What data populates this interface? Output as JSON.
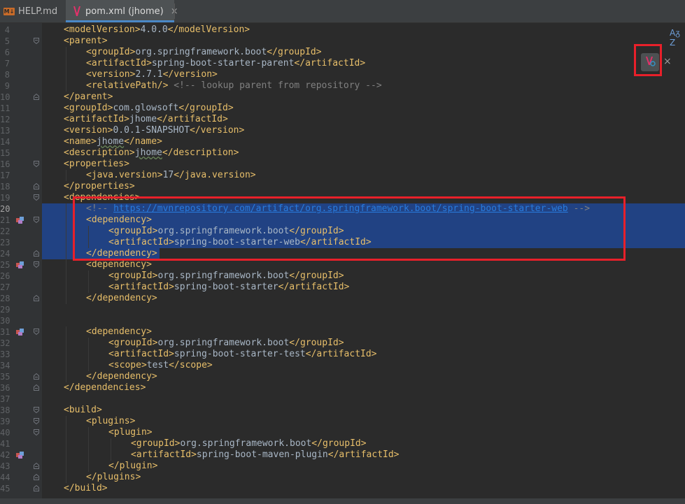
{
  "tabs": [
    {
      "label": "HELP.md",
      "icon": "markdown-icon",
      "icon_text": "M↓",
      "active": false
    },
    {
      "label": "pom.xml (jhome)",
      "icon": "maven-icon",
      "active": true
    }
  ],
  "tab_close_glyph": "×",
  "toolbar": {
    "reader_mode_glyph": "Aᵹ Z",
    "load_maven_icon": "maven-reload-icon",
    "close_glyph": "×"
  },
  "colors": {
    "tag": "#e8bf6a",
    "text": "#a9b7c6",
    "comment": "#808080",
    "link": "#287bde",
    "selection": "#214283",
    "highlight_box": "#e8202a"
  },
  "lines": [
    {
      "num": "4",
      "indent": 1,
      "tokens": [
        [
          "tag",
          "<modelVersion>"
        ],
        [
          "txt",
          "4.0.0"
        ],
        [
          "tag",
          "</modelVersion>"
        ]
      ]
    },
    {
      "num": "5",
      "indent": 1,
      "fold": "open",
      "tokens": [
        [
          "tag",
          "<parent>"
        ]
      ]
    },
    {
      "num": "6",
      "indent": 2,
      "tokens": [
        [
          "tag",
          "<groupId>"
        ],
        [
          "txt",
          "org.springframework.boot"
        ],
        [
          "tag",
          "</groupId>"
        ]
      ]
    },
    {
      "num": "7",
      "indent": 2,
      "tokens": [
        [
          "tag",
          "<artifactId>"
        ],
        [
          "txt",
          "spring-boot-starter-parent"
        ],
        [
          "tag",
          "</artifactId>"
        ]
      ]
    },
    {
      "num": "8",
      "indent": 2,
      "tokens": [
        [
          "tag",
          "<version>"
        ],
        [
          "txt",
          "2.7.1"
        ],
        [
          "tag",
          "</version>"
        ]
      ]
    },
    {
      "num": "9",
      "indent": 2,
      "tokens": [
        [
          "tag",
          "<relativePath/>"
        ],
        [
          "txt",
          " "
        ],
        [
          "cmt",
          "<!-- lookup parent from repository -->"
        ]
      ]
    },
    {
      "num": "10",
      "indent": 1,
      "fold": "close",
      "tokens": [
        [
          "tag",
          "</parent>"
        ]
      ]
    },
    {
      "num": "11",
      "indent": 1,
      "tokens": [
        [
          "tag",
          "<groupId>"
        ],
        [
          "txt",
          "com.glowsoft"
        ],
        [
          "tag",
          "</groupId>"
        ]
      ]
    },
    {
      "num": "12",
      "indent": 1,
      "tokens": [
        [
          "tag",
          "<artifactId>"
        ],
        [
          "txt",
          "jhome"
        ],
        [
          "tag",
          "</artifactId>"
        ]
      ]
    },
    {
      "num": "13",
      "indent": 1,
      "tokens": [
        [
          "tag",
          "<version>"
        ],
        [
          "txt",
          "0.0.1-SNAPSHOT"
        ],
        [
          "tag",
          "</version>"
        ]
      ]
    },
    {
      "num": "14",
      "indent": 1,
      "tokens": [
        [
          "tag",
          "<name>"
        ],
        [
          "wav",
          "jhome"
        ],
        [
          "tag",
          "</name>"
        ]
      ]
    },
    {
      "num": "15",
      "indent": 1,
      "tokens": [
        [
          "tag",
          "<description>"
        ],
        [
          "wav",
          "jhome"
        ],
        [
          "tag",
          "</description>"
        ]
      ]
    },
    {
      "num": "16",
      "indent": 1,
      "fold": "open",
      "tokens": [
        [
          "tag",
          "<properties>"
        ]
      ]
    },
    {
      "num": "17",
      "indent": 2,
      "tokens": [
        [
          "tag",
          "<java.version>"
        ],
        [
          "txt",
          "17"
        ],
        [
          "tag",
          "</java.version>"
        ]
      ]
    },
    {
      "num": "18",
      "indent": 1,
      "fold": "close",
      "tokens": [
        [
          "tag",
          "</properties>"
        ]
      ]
    },
    {
      "num": "19",
      "indent": 1,
      "fold": "open",
      "tokens": [
        [
          "tag",
          "<dependencies>"
        ]
      ]
    },
    {
      "num": "20",
      "indent": 2,
      "sel": true,
      "cur": true,
      "tokens": [
        [
          "cmt",
          "<!-- "
        ],
        [
          "url",
          "https://mvnrepository.com/artifact/org.springframework.boot/spring-boot-starter-web"
        ],
        [
          "cmt",
          " -->"
        ]
      ]
    },
    {
      "num": "21",
      "indent": 2,
      "sel": true,
      "fold": "open",
      "gicon": true,
      "tokens": [
        [
          "tag",
          "<dependency>"
        ]
      ]
    },
    {
      "num": "22",
      "indent": 3,
      "sel": true,
      "tokens": [
        [
          "tag",
          "<groupId>"
        ],
        [
          "txt",
          "org.springframework.boot"
        ],
        [
          "tag",
          "</groupId>"
        ]
      ]
    },
    {
      "num": "23",
      "indent": 3,
      "sel": true,
      "tokens": [
        [
          "tag",
          "<artifactId>"
        ],
        [
          "txt",
          "spring-boot-starter-web"
        ],
        [
          "tag",
          "</artifactId>"
        ]
      ]
    },
    {
      "num": "24",
      "indent": 2,
      "sel": true,
      "last": true,
      "fold": "close",
      "tokens": [
        [
          "tag",
          "</dependency>"
        ]
      ]
    },
    {
      "num": "25",
      "indent": 2,
      "fold": "open",
      "gicon": true,
      "tokens": [
        [
          "tag",
          "<dependency>"
        ]
      ]
    },
    {
      "num": "26",
      "indent": 3,
      "tokens": [
        [
          "tag",
          "<groupId>"
        ],
        [
          "txt",
          "org.springframework.boot"
        ],
        [
          "tag",
          "</groupId>"
        ]
      ]
    },
    {
      "num": "27",
      "indent": 3,
      "tokens": [
        [
          "tag",
          "<artifactId>"
        ],
        [
          "txt",
          "spring-boot-starter"
        ],
        [
          "tag",
          "</artifactId>"
        ]
      ]
    },
    {
      "num": "28",
      "indent": 2,
      "fold": "close",
      "tokens": [
        [
          "tag",
          "</dependency>"
        ]
      ]
    },
    {
      "num": "29",
      "indent": 0,
      "tokens": []
    },
    {
      "num": "30",
      "indent": 0,
      "tokens": []
    },
    {
      "num": "31",
      "indent": 2,
      "fold": "open",
      "gicon": true,
      "tokens": [
        [
          "tag",
          "<dependency>"
        ]
      ]
    },
    {
      "num": "32",
      "indent": 3,
      "tokens": [
        [
          "tag",
          "<groupId>"
        ],
        [
          "txt",
          "org.springframework.boot"
        ],
        [
          "tag",
          "</groupId>"
        ]
      ]
    },
    {
      "num": "33",
      "indent": 3,
      "tokens": [
        [
          "tag",
          "<artifactId>"
        ],
        [
          "txt",
          "spring-boot-starter-test"
        ],
        [
          "tag",
          "</artifactId>"
        ]
      ]
    },
    {
      "num": "34",
      "indent": 3,
      "tokens": [
        [
          "tag",
          "<scope>"
        ],
        [
          "txt",
          "test"
        ],
        [
          "tag",
          "</scope>"
        ]
      ]
    },
    {
      "num": "35",
      "indent": 2,
      "fold": "close",
      "tokens": [
        [
          "tag",
          "</dependency>"
        ]
      ]
    },
    {
      "num": "36",
      "indent": 1,
      "fold": "close",
      "tokens": [
        [
          "tag",
          "</dependencies>"
        ]
      ]
    },
    {
      "num": "37",
      "indent": 0,
      "tokens": []
    },
    {
      "num": "38",
      "indent": 1,
      "fold": "open",
      "tokens": [
        [
          "tag",
          "<build>"
        ]
      ]
    },
    {
      "num": "39",
      "indent": 2,
      "fold": "open",
      "tokens": [
        [
          "tag",
          "<plugins>"
        ]
      ]
    },
    {
      "num": "40",
      "indent": 3,
      "fold": "open",
      "tokens": [
        [
          "tag",
          "<plugin>"
        ]
      ]
    },
    {
      "num": "41",
      "indent": 4,
      "tokens": [
        [
          "tag",
          "<groupId>"
        ],
        [
          "txt",
          "org.springframework.boot"
        ],
        [
          "tag",
          "</groupId>"
        ]
      ]
    },
    {
      "num": "42",
      "indent": 4,
      "gicon": true,
      "tokens": [
        [
          "tag",
          "<artifactId>"
        ],
        [
          "txt",
          "spring-boot-maven-plugin"
        ],
        [
          "tag",
          "</artifactId>"
        ]
      ]
    },
    {
      "num": "43",
      "indent": 3,
      "fold": "close",
      "tokens": [
        [
          "tag",
          "</plugin>"
        ]
      ]
    },
    {
      "num": "44",
      "indent": 2,
      "fold": "close",
      "tokens": [
        [
          "tag",
          "</plugins>"
        ]
      ]
    },
    {
      "num": "45",
      "indent": 1,
      "fold": "close",
      "tokens": [
        [
          "tag",
          "</build>"
        ]
      ]
    }
  ]
}
